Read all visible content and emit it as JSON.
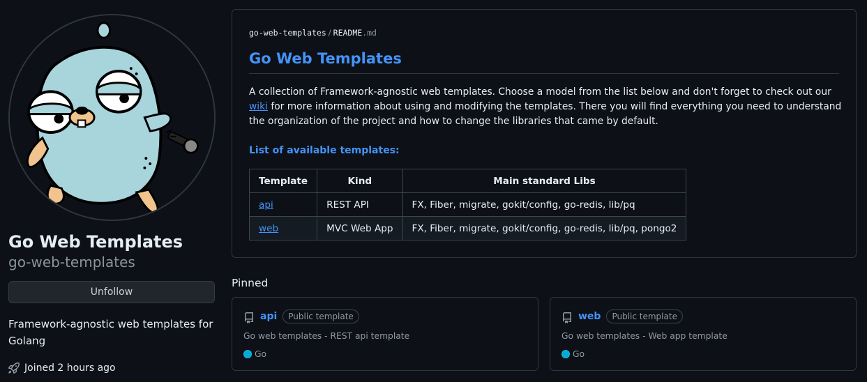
{
  "profile": {
    "name": "Go Web Templates",
    "login": "go-web-templates",
    "unfollow_label": "Unfollow",
    "bio": "Framework-agnostic web templates for Golang",
    "joined": "Joined 2 hours ago"
  },
  "readme": {
    "breadcrumb_repo": "go-web-templates",
    "breadcrumb_sep": "/",
    "breadcrumb_file": "README",
    "breadcrumb_ext": ".md",
    "title": "Go Web Templates",
    "desc_before": "A collection of Framework-agnostic web templates. Choose a model from the list below and don't forget to check out our ",
    "desc_link": "wiki",
    "desc_after": " for more information about using and modifying the templates. There you will find everything you need to understand the organization of the project and how to change the libraries that came by default.",
    "list_heading": "List of available templates:",
    "table": {
      "headers": [
        "Template",
        "Kind",
        "Main standard Libs"
      ],
      "rows": [
        [
          "api",
          "REST API",
          "FX, Fiber, migrate, gokit/config, go-redis, lib/pq"
        ],
        [
          "web",
          "MVC Web App",
          "FX, Fiber, migrate, gokit/config, go-redis, lib/pq, pongo2"
        ]
      ]
    }
  },
  "pinned": {
    "label": "Pinned",
    "items": [
      {
        "name": "api",
        "badge": "Public template",
        "description": "Go web templates - REST api template",
        "language": "Go",
        "language_color": "#00ADD8"
      },
      {
        "name": "web",
        "badge": "Public template",
        "description": "Go web templates - Web app template",
        "language": "Go",
        "language_color": "#00ADD8"
      }
    ]
  },
  "icons": {
    "avatar": "gopher-avatar",
    "joined": "rocket-icon",
    "repo": "repo-template-icon"
  }
}
